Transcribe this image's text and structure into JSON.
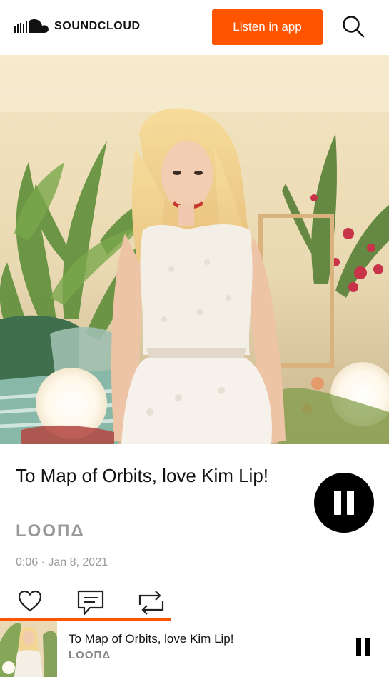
{
  "header": {
    "brand": "SOUNDCLOUD",
    "listen_button": "Listen in app",
    "search_icon": "search-icon"
  },
  "track": {
    "title": "To Map of Orbits, love Kim Lip!",
    "artist": "LOOΠΔ",
    "meta": "0:06 · Jan 8, 2021",
    "state": "playing"
  },
  "actions": [
    {
      "icon": "heart-icon"
    },
    {
      "icon": "comment-icon"
    },
    {
      "icon": "repost-icon"
    }
  ],
  "progress": {
    "fraction": 0.44,
    "color": "#ff5500"
  },
  "mini_player": {
    "title": "To Map of Orbits, love Kim Lip!",
    "artist": "LOOΠΔ"
  },
  "colors": {
    "accent": "#ff5500",
    "meta_gray": "#999999"
  }
}
